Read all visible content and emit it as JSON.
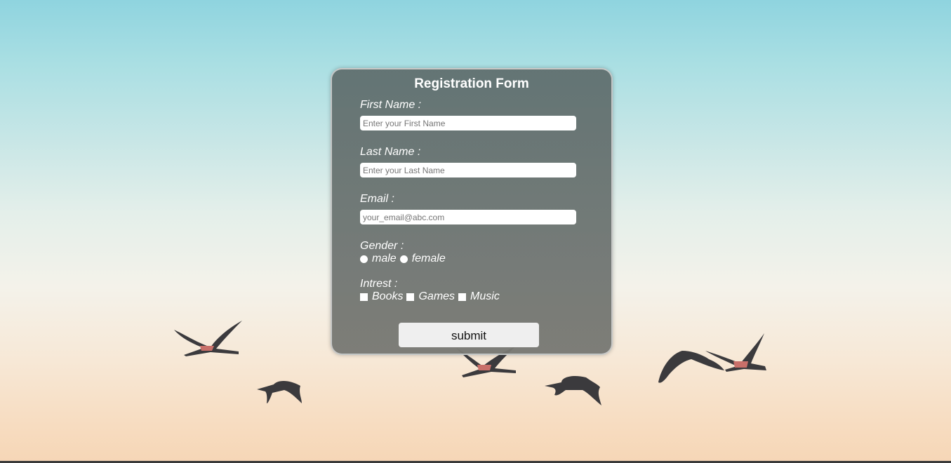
{
  "form": {
    "title": "Registration Form",
    "first_name": {
      "label": "First Name :",
      "placeholder": "Enter your First Name",
      "value": ""
    },
    "last_name": {
      "label": "Last Name :",
      "placeholder": "Enter your Last Name",
      "value": ""
    },
    "email": {
      "label": "Email :",
      "placeholder": "your_email@abc.com",
      "value": ""
    },
    "gender": {
      "label": "Gender :",
      "options": [
        "male",
        "female"
      ]
    },
    "interest": {
      "label": "Intrest :",
      "options": [
        "Books",
        "Games",
        "Music"
      ]
    },
    "submit_label": "submit"
  }
}
